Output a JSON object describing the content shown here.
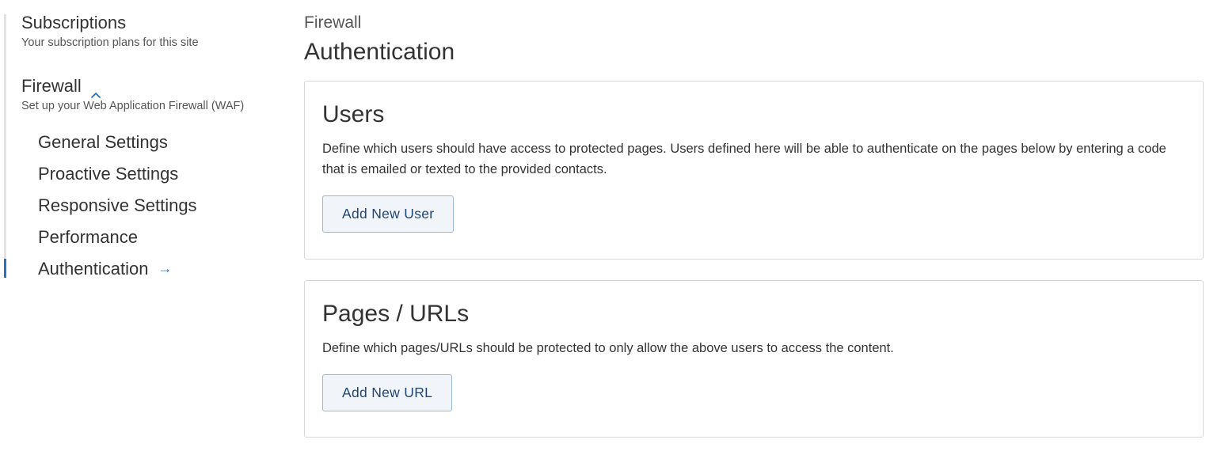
{
  "sidebar": {
    "subscriptions": {
      "title": "Subscriptions",
      "subtitle": "Your subscription plans for this site"
    },
    "firewall": {
      "title": "Firewall",
      "subtitle": "Set up your Web Application Firewall (WAF)",
      "items": [
        {
          "label": "General Settings"
        },
        {
          "label": "Proactive Settings"
        },
        {
          "label": "Responsive Settings"
        },
        {
          "label": "Performance"
        },
        {
          "label": "Authentication",
          "active": true
        }
      ]
    }
  },
  "main": {
    "breadcrumb": "Firewall",
    "title": "Authentication",
    "users_card": {
      "title": "Users",
      "description": "Define which users should have access to protected pages. Users defined here will be able to authenticate on the pages below by entering a code that is emailed or texted to the provided contacts.",
      "button_label": "Add New User"
    },
    "pages_card": {
      "title": "Pages / URLs",
      "description": "Define which pages/URLs should be protected to only allow the above users to access the content.",
      "button_label": "Add New URL"
    }
  },
  "colors": {
    "accent": "#2d6fc0",
    "button_text": "#1f4675",
    "button_bg": "#f1f4f9"
  },
  "icons": {
    "firewall_toggle": "chevron-up-icon",
    "active_item": "arrow-right-icon"
  }
}
